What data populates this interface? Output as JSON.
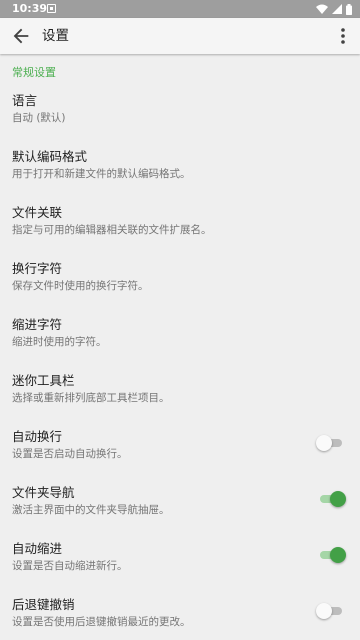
{
  "status_bar": {
    "time": "10:39",
    "icons": [
      "notification-icon",
      "wifi-icon",
      "signal-icon",
      "battery-icon"
    ]
  },
  "app_bar": {
    "title": "设置",
    "back_icon": "arrow-back-icon",
    "more_icon": "more-vert-icon"
  },
  "colors": {
    "accent": "#4caf50",
    "switch_on": "#43a047",
    "background": "#efefef"
  },
  "category": "常规设置",
  "preferences": [
    {
      "title": "语言",
      "summary": "自动 (默认)"
    },
    {
      "title": "默认编码格式",
      "summary": "用于打开和新建文件的默认编码格式。"
    },
    {
      "title": "文件关联",
      "summary": "指定与可用的编辑器相关联的文件扩展名。"
    },
    {
      "title": "换行字符",
      "summary": "保存文件时使用的换行字符。"
    },
    {
      "title": "缩进字符",
      "summary": "缩进时使用的字符。"
    },
    {
      "title": "迷你工具栏",
      "summary": "选择或重新排列底部工具栏项目。"
    },
    {
      "title": "自动换行",
      "summary": "设置是否启动自动换行。",
      "switch": false
    },
    {
      "title": "文件夹导航",
      "summary": "激活主界面中的文件夹导航抽屉。",
      "switch": true
    },
    {
      "title": "自动缩进",
      "summary": "设置是否自动缩进新行。",
      "switch": true
    },
    {
      "title": "后退键撤销",
      "summary": "设置是否使用后退键撤销最近的更改。",
      "switch": false
    }
  ]
}
